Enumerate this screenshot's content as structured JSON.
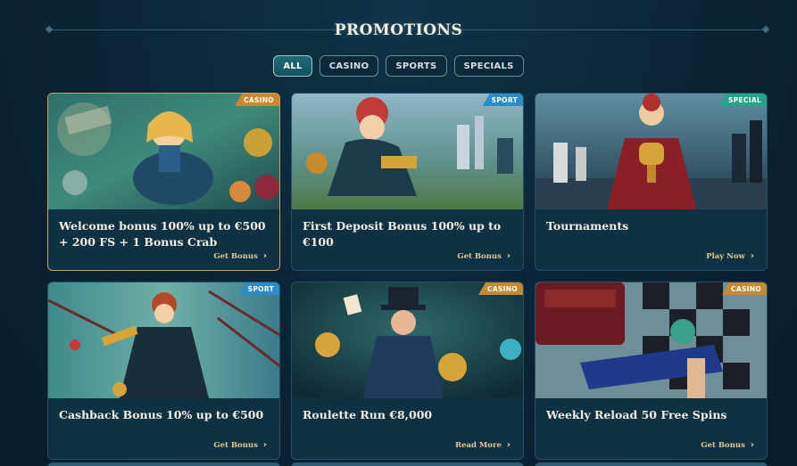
{
  "header": {
    "title": "PROMOTIONS"
  },
  "tabs": [
    {
      "label": "ALL",
      "active": true
    },
    {
      "label": "CASINO",
      "active": false
    },
    {
      "label": "SPORTS",
      "active": false
    },
    {
      "label": "SPECIALS",
      "active": false
    }
  ],
  "cards": [
    {
      "badge": "CASINO",
      "title": "Welcome bonus 100% up to €500 + 200 FS + 1 Bonus Crab",
      "cta": "Get Bonus"
    },
    {
      "badge": "SPORT",
      "title": "First Deposit Bonus 100% up to €100",
      "cta": "Get Bonus"
    },
    {
      "badge": "SPECIAL",
      "title": "Tournaments",
      "cta": "Play Now"
    },
    {
      "badge": "SPORT",
      "title": "Cashback Bonus 10% up to €500",
      "cta": "Get Bonus"
    },
    {
      "badge": "CASINO",
      "title": "Roulette Run €8,000",
      "cta": "Read More"
    },
    {
      "badge": "CASINO",
      "title": "Weekly Reload 50 Free Spins",
      "cta": "Get Bonus"
    }
  ],
  "colors": {
    "casino": "#c9892e",
    "sport": "#2c8cc8",
    "special": "#23a58a",
    "accent": "#e2c792"
  }
}
